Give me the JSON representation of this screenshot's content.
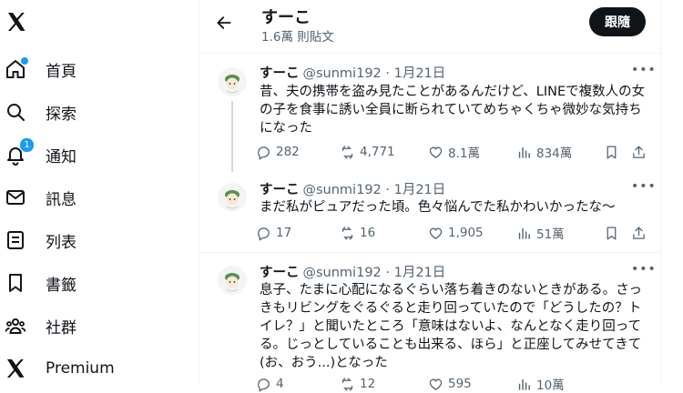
{
  "sidebar": {
    "logo": "x-logo-icon",
    "items": [
      {
        "label": "首頁",
        "icon": "home-icon"
      },
      {
        "label": "探索",
        "icon": "search-icon"
      },
      {
        "label": "通知",
        "icon": "bell-icon",
        "badge": "1"
      },
      {
        "label": "訊息",
        "icon": "mail-icon"
      },
      {
        "label": "列表",
        "icon": "list-icon"
      },
      {
        "label": "書籤",
        "icon": "bookmark-icon"
      },
      {
        "label": "社群",
        "icon": "communities-icon"
      },
      {
        "label": "Premium",
        "icon": "x-logo-icon"
      }
    ]
  },
  "header": {
    "name": "すーこ",
    "subtitle": "1.6萬 則貼文",
    "follow_label": "跟隨"
  },
  "tweets": [
    {
      "name": "すーこ",
      "meta": "@sunmi192 · 1月21日",
      "text": "昔、夫の携帯を盗み見たことがあるんだけど、LINEで複数人の女の子を食事に誘い全員に断られていてめちゃくちゃ微妙な気持ちになった",
      "replies": "282",
      "retweets": "4,771",
      "likes": "8.1萬",
      "views": "834萬"
    },
    {
      "name": "すーこ",
      "meta": "@sunmi192 · 1月21日",
      "text": "まだ私がピュアだった頃。色々悩んでた私かわいかったな〜",
      "replies": "17",
      "retweets": "16",
      "likes": "1,905",
      "views": "51萬"
    },
    {
      "name": "すーこ",
      "meta": "@sunmi192 · 1月21日",
      "text": "息子、たまに心配になるぐらい落ち着きのないときがある。さっきもリビングをぐるぐると走り回っていたので「どうしたの？トイレ？」と聞いたところ「意味はないよ、なんとなく走り回ってる。じっとしていることも出来る、ほら」と正座してみせてきて(お、おう...)となった",
      "replies": "4",
      "retweets": "12",
      "likes": "595",
      "views": "10萬"
    }
  ]
}
